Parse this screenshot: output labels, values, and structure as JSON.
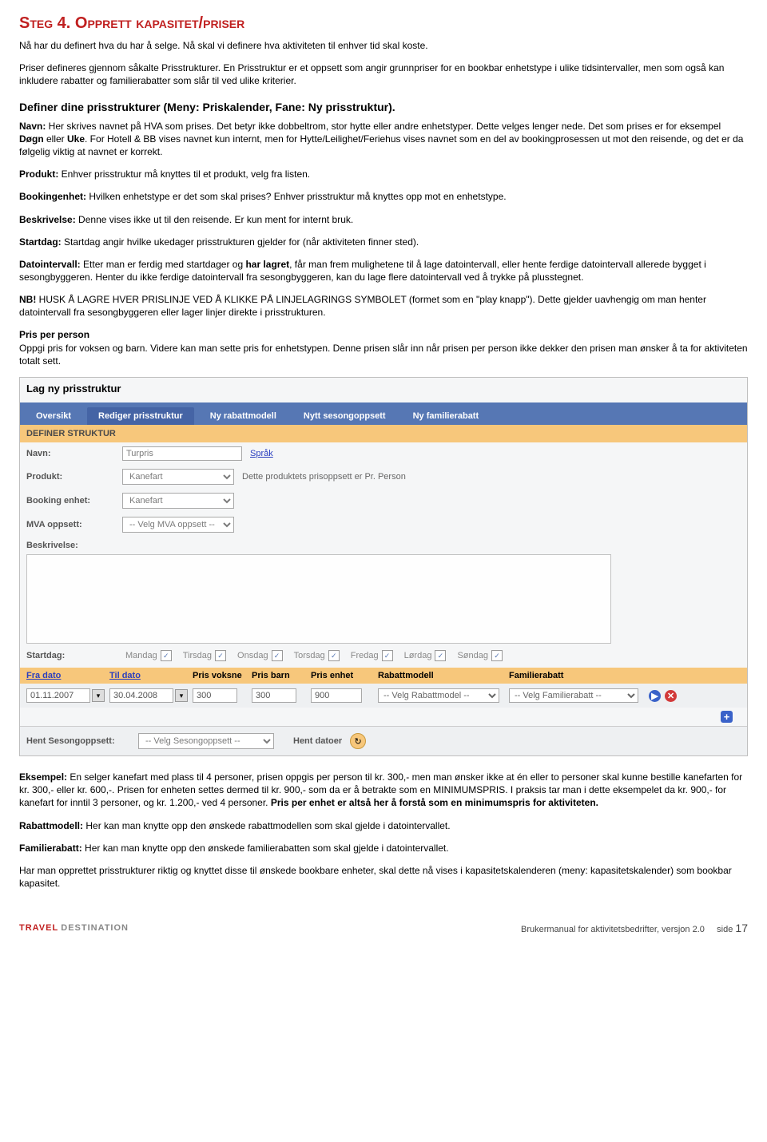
{
  "heading": "Steg 4. Opprett kapasitet/priser",
  "intro1": "Nå har du definert hva du har å selge. Nå skal vi definere hva aktiviteten til enhver tid skal koste.",
  "intro2": "Priser defineres gjennom såkalte Prisstrukturer. En Prisstruktur er et oppsett som angir grunnpriser for en bookbar enhetstype i ulike tidsintervaller, men som også kan inkludere rabatter og familierabatter som slår til ved ulike kriterier.",
  "sect1_title": "Definer dine prisstrukturer (Meny: Priskalender, Fane: Ny prisstruktur).",
  "navn_label": "Navn:",
  "navn_text": " Her skrives navnet på HVA som prises. Det betyr ikke dobbeltrom, stor hytte eller andre enhetstyper. Dette velges lenger nede. Det som prises er for eksempel ",
  "navn_bold1": "Døgn",
  "navn_mid": " eller ",
  "navn_bold2": "Uke",
  "navn_tail": ". For Hotell & BB vises navnet kun internt, men for Hytte/Leilighet/Feriehus vises navnet som en del av bookingprosessen ut mot den reisende, og det er da følgelig viktig at navnet er korrekt.",
  "produkt_label": "Produkt:",
  "produkt_text": " Enhver prisstruktur må knyttes til et produkt, velg fra listen.",
  "benhet_label": "Bookingenhet:",
  "benhet_text": " Hvilken enhetstype er det som skal prises? Enhver prisstruktur må knyttes opp mot en enhetstype.",
  "beskr_label": "Beskrivelse:",
  "beskr_text": " Denne vises ikke ut til den reisende. Er kun ment for internt bruk.",
  "startdag_label": "Startdag:",
  "startdag_text": " Startdag angir hvilke ukedager prisstrukturen gjelder for (når aktiviteten finner sted).",
  "dato_label": "Datointervall:",
  "dato_text": " Etter man er ferdig med startdager og ",
  "dato_bold": "har lagret",
  "dato_tail": ", får man frem mulighetene til å lage datointervall, eller hente ferdige datointervall allerede bygget i sesongbyggeren. Henter du ikke ferdige datointervall fra sesongbyggeren, kan du lage flere datointervall ved å trykke på plusstegnet.",
  "nb_label": "NB!",
  "nb_text": " HUSK Å LAGRE HVER PRISLINJE VED Å KLIKKE PÅ LINJELAGRINGS SYMBOLET (formet som en \"play knapp\"). Dette gjelder uavhengig om man henter datointervall fra sesongbyggeren eller lager linjer direkte i prisstrukturen.",
  "ppp_title": "Pris per person",
  "ppp_text": "Oppgi pris for voksen og barn. Videre kan man sette pris for enhetstypen. Denne prisen slår inn når prisen per person ikke dekker den prisen man ønsker å ta for aktiviteten totalt sett.",
  "app": {
    "title": "Lag ny prisstruktur",
    "tabs": [
      "Oversikt",
      "Rediger prisstruktur",
      "Ny rabattmodell",
      "Nytt sesongoppsett",
      "Ny familierabatt"
    ],
    "yellowhead": "DEFINER STRUKTUR",
    "labels": {
      "navn": "Navn:",
      "produkt": "Produkt:",
      "benhet": "Booking enhet:",
      "mva": "MVA oppsett:",
      "beskr": "Beskrivelse:",
      "startdag": "Startdag:",
      "hent": "Hent Sesongoppsett:",
      "hentdatoer": "Hent datoer"
    },
    "values": {
      "navn": "Turpris",
      "produkt": "Kanefart",
      "benhet": "Kanefart",
      "mva": "-- Velg MVA oppsett --",
      "hent": "-- Velg Sesongoppsett --"
    },
    "sprak": "Språk",
    "prodnote": "Dette produktets prisoppsett er Pr. Person",
    "days": [
      "Mandag",
      "Tirsdag",
      "Onsdag",
      "Torsdag",
      "Fredag",
      "Lørdag",
      "Søndag"
    ],
    "cols": {
      "fra": "Fra dato",
      "til": "Til dato",
      "pv": "Pris voksne",
      "pb": "Pris barn",
      "pe": "Pris enhet",
      "rm": "Rabattmodell",
      "fr": "Familierabatt"
    },
    "row": {
      "fra": "01.11.2007",
      "til": "30.04.2008",
      "pv": "300",
      "pb": "300",
      "pe": "900",
      "rm": "-- Velg Rabattmodel --",
      "fr": "-- Velg Familierabatt --"
    }
  },
  "eks_label": "Eksempel:",
  "eks_text": " En selger kanefart med plass til 4 personer, prisen oppgis per person til kr. 300,- men man ønsker ikke at én eller to personer skal kunne bestille kanefarten for kr. 300,- eller kr. 600,-. Prisen for enheten settes dermed til kr. 900,- som da er å betrakte som en MINIMUMSPRIS. I praksis tar man i dette eksempelet da kr. 900,- for kanefart for inntil 3 personer, og kr. 1.200,- ved 4 personer. ",
  "eks_bold": "Pris per enhet er altså her å forstå som en minimumspris for aktiviteten.",
  "rabm_label": "Rabattmodell:",
  "rabm_text": " Her kan man knytte opp den ønskede rabattmodellen som skal gjelde i datointervallet.",
  "famr_label": "Familierabatt:",
  "famr_text": " Her kan man knytte opp den ønskede familierabatten som skal gjelde i datointervallet.",
  "closing": "Har man opprettet prisstrukturer riktig og knyttet disse til ønskede bookbare enheter, skal dette nå vises i kapasitetskalenderen (meny: kapasitetskalender) som bookbar kapasitet.",
  "footer": {
    "brand1": "TRAVEL",
    "brand2": "DESTINATION",
    "doc": "Brukermanual for aktivitetsbedrifter, versjon 2.0",
    "page_label": "side ",
    "page": "17"
  }
}
